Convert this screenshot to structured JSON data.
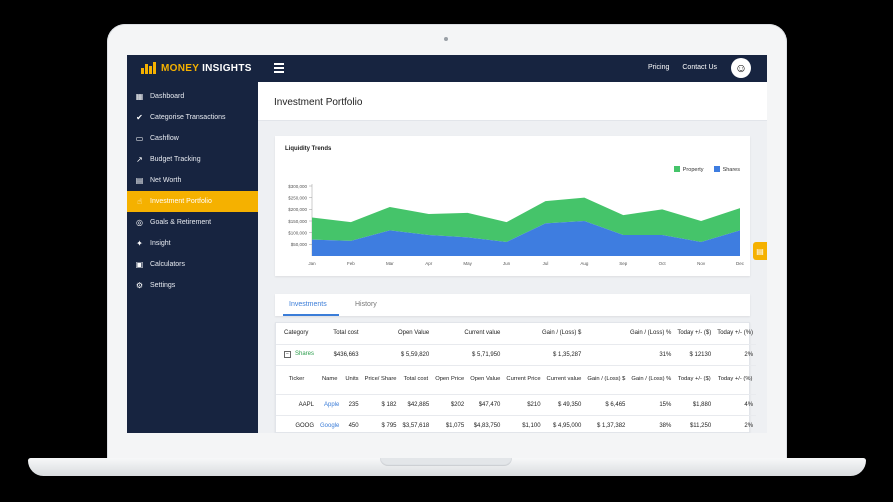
{
  "brand": {
    "name_part1": "MONEY",
    "name_part2": " INSIGHTS",
    "accent": "#f5b100",
    "nav_bg": "#172440"
  },
  "topnav": {
    "menu_icon": "hamburger-icon",
    "links": [
      "Pricing",
      "Contact Us"
    ]
  },
  "sidebar": {
    "items": [
      {
        "label": "Dashboard",
        "icon": "grid-icon",
        "active": false
      },
      {
        "label": "Categorise Transactions",
        "icon": "check-circle-icon",
        "active": false
      },
      {
        "label": "Cashflow",
        "icon": "card-icon",
        "active": false
      },
      {
        "label": "Budget Tracking",
        "icon": "trend-icon",
        "active": false
      },
      {
        "label": "Net Worth",
        "icon": "calendar-icon",
        "active": false
      },
      {
        "label": "Investment Portfolio",
        "icon": "hand-icon",
        "active": true
      },
      {
        "label": "Goals & Retirement",
        "icon": "target-icon",
        "active": false
      },
      {
        "label": "Insight",
        "icon": "bulb-icon",
        "active": false
      },
      {
        "label": "Calculators",
        "icon": "calculator-icon",
        "active": false
      },
      {
        "label": "Settings",
        "icon": "gear-icon",
        "active": false
      }
    ]
  },
  "page": {
    "title": "Investment Portfolio"
  },
  "chart_data": {
    "type": "area",
    "title": "Liquidity Trends",
    "categories": [
      "Jan",
      "Feb",
      "Mar",
      "Apr",
      "May",
      "Jun",
      "Jul",
      "Aug",
      "Sep",
      "Oct",
      "Nov",
      "Dec"
    ],
    "y_ticks": [
      "$300,000",
      "$250,000",
      "$200,000",
      "$150,000",
      "$100,000",
      "$50,000"
    ],
    "ylim": [
      0,
      300000
    ],
    "stacked": true,
    "legend_position": "top-right",
    "series": [
      {
        "name": "Property",
        "color": "#45c46a",
        "values": [
          95000,
          80000,
          100000,
          90000,
          105000,
          85000,
          95000,
          100000,
          85000,
          110000,
          90000,
          95000
        ]
      },
      {
        "name": "Shares",
        "color": "#3e7de0",
        "values": [
          70000,
          65000,
          110000,
          90000,
          80000,
          60000,
          140000,
          150000,
          90000,
          90000,
          60000,
          110000
        ]
      }
    ]
  },
  "tabs": [
    {
      "label": "Investments",
      "active": true
    },
    {
      "label": "History",
      "active": false
    }
  ],
  "table": {
    "headers": [
      "Category",
      "Total cost",
      "Open Value",
      "Current value",
      "Gain / (Loss) $",
      "Gain / (Loss) %",
      "Today +/- ($)",
      "Today +/- (%)"
    ],
    "category_row": [
      "Shares",
      "$436,663",
      "$ 5,59,820",
      "$ 5,71,950",
      "$ 1,35,287",
      "31%",
      "$ 12130",
      "2%"
    ],
    "sub_headers": [
      "Ticker",
      "Name",
      "Units",
      "Price/ Share",
      "Total cost",
      "Open Price",
      "Open Value",
      "Current Price",
      "Current value",
      "Gain / (Loss) $",
      "Gain / (Loss) %",
      "Today +/- ($)",
      "Today +/- (%)"
    ],
    "rows": [
      [
        "AAPL",
        "Apple",
        "235",
        "$ 182",
        "$42,885",
        "$202",
        "$47,470",
        "$210",
        "$ 49,350",
        "$ 6,465",
        "15%",
        "$1,880",
        "4%"
      ],
      [
        "GOOG",
        "Google",
        "450",
        "$ 795",
        "$3,57,618",
        "$1,075",
        "$4,83,750",
        "$1,100",
        "$ 4,95,000",
        "$ 1,37,382",
        "38%",
        "$11,250",
        "2%"
      ]
    ]
  }
}
